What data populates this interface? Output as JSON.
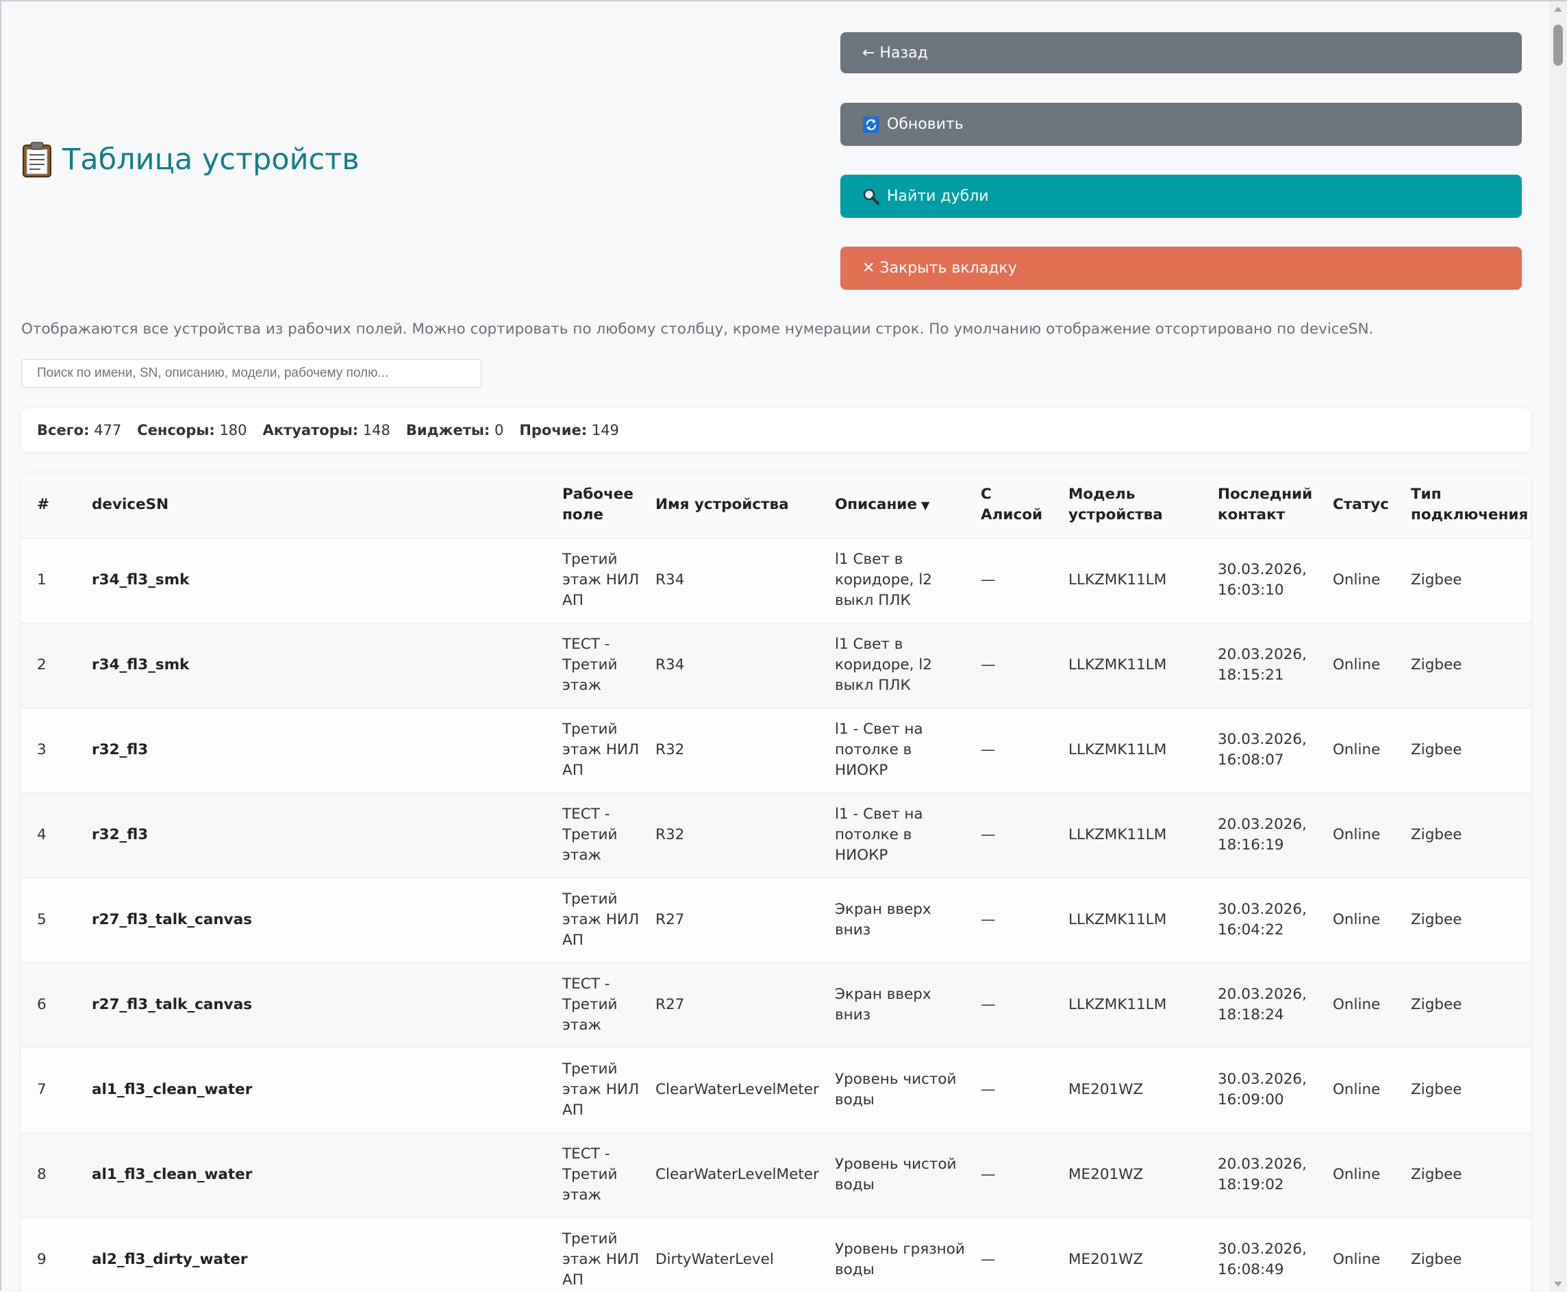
{
  "page": {
    "title": "Таблица устройств",
    "description": "Отображаются все устройства из рабочих полей. Можно сортировать по любому столбцу, кроме нумерации строк. По умолчанию отображение отсортировано по deviceSN."
  },
  "buttons": {
    "back": "← Назад",
    "refresh": "Обновить",
    "find_dupes": "Найти дубли",
    "close_tab": "✕ Закрыть вкладку"
  },
  "search": {
    "placeholder": "Поиск по имени, SN, описанию, модели, рабочему полю..."
  },
  "stats": [
    {
      "label": "Всего:",
      "value": "477"
    },
    {
      "label": "Сенсоры:",
      "value": "180"
    },
    {
      "label": "Актуаторы:",
      "value": "148"
    },
    {
      "label": "Виджеты:",
      "value": "0"
    },
    {
      "label": "Прочие:",
      "value": "149"
    }
  ],
  "table": {
    "columns": [
      "#",
      "deviceSN",
      "Рабочее поле",
      "Имя устройства",
      "Описание",
      "С Алисой",
      "Модель устройства",
      "Последний контакт",
      "Статус",
      "Тип подключения"
    ],
    "sorted_column": "Описание",
    "sort_indicator": "▼",
    "rows": [
      [
        "1",
        "r34_fl3_smk",
        "Третий этаж НИЛ АП",
        "R34",
        "l1 Свет в коридоре, l2 выкл ПЛК",
        "—",
        "LLKZMK11LM",
        "30.03.2026, 16:03:10",
        "Online",
        "Zigbee"
      ],
      [
        "2",
        "r34_fl3_smk",
        "ТЕСТ - Третий этаж",
        "R34",
        "l1 Свет в коридоре, l2 выкл ПЛК",
        "—",
        "LLKZMK11LM",
        "20.03.2026, 18:15:21",
        "Online",
        "Zigbee"
      ],
      [
        "3",
        "r32_fl3",
        "Третий этаж НИЛ АП",
        "R32",
        "l1 - Свет на потолке в НИОКР",
        "—",
        "LLKZMK11LM",
        "30.03.2026, 16:08:07",
        "Online",
        "Zigbee"
      ],
      [
        "4",
        "r32_fl3",
        "ТЕСТ - Третий этаж",
        "R32",
        "l1 - Свет на потолке в НИОКР",
        "—",
        "LLKZMK11LM",
        "20.03.2026, 18:16:19",
        "Online",
        "Zigbee"
      ],
      [
        "5",
        "r27_fl3_talk_canvas",
        "Третий этаж НИЛ АП",
        "R27",
        "Экран вверх вниз",
        "—",
        "LLKZMK11LM",
        "30.03.2026, 16:04:22",
        "Online",
        "Zigbee"
      ],
      [
        "6",
        "r27_fl3_talk_canvas",
        "ТЕСТ - Третий этаж",
        "R27",
        "Экран вверх вниз",
        "—",
        "LLKZMK11LM",
        "20.03.2026, 18:18:24",
        "Online",
        "Zigbee"
      ],
      [
        "7",
        "al1_fl3_clean_water",
        "Третий этаж НИЛ АП",
        "ClearWaterLevelMeter",
        "Уровень чистой воды",
        "—",
        "ME201WZ",
        "30.03.2026, 16:09:00",
        "Online",
        "Zigbee"
      ],
      [
        "8",
        "al1_fl3_clean_water",
        "ТЕСТ - Третий этаж",
        "ClearWaterLevelMeter",
        "Уровень чистой воды",
        "—",
        "ME201WZ",
        "20.03.2026, 18:19:02",
        "Online",
        "Zigbee"
      ],
      [
        "9",
        "al2_fl3_dirty_water",
        "Третий этаж НИЛ АП",
        "DirtyWaterLevel",
        "Уровень грязной воды",
        "—",
        "ME201WZ",
        "30.03.2026, 16:08:49",
        "Online",
        "Zigbee"
      ]
    ]
  },
  "colors": {
    "title": "#137e86",
    "back_button": "#6c757d",
    "refresh_button": "#6c757d",
    "dupes_button": "#009da4",
    "close_button": "#e27055"
  },
  "icons": {
    "title": "clipboard-icon",
    "refresh": "refresh-icon",
    "find_dupes": "magnifier-icon"
  }
}
